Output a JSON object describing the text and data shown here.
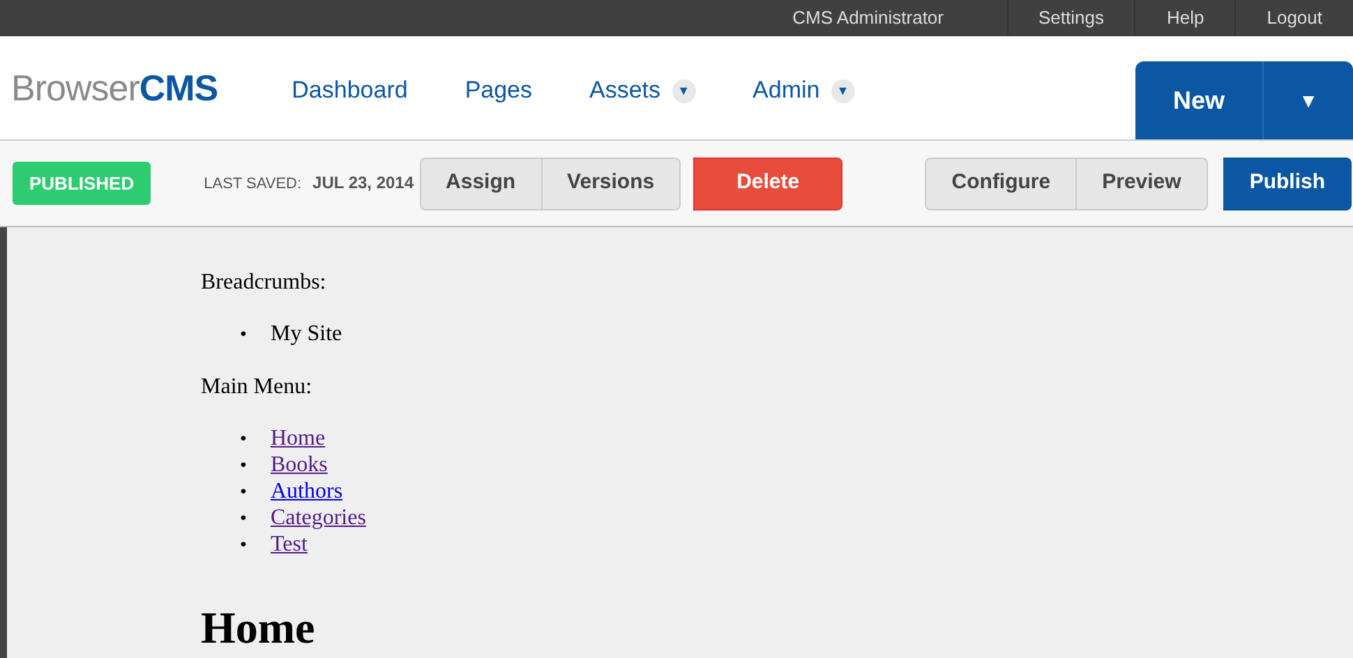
{
  "top_bar": {
    "user": "CMS Administrator",
    "links": [
      "Settings",
      "Help",
      "Logout"
    ]
  },
  "header": {
    "logo": "Browser**CMS**",
    "nav": [
      {
        "label": "Dashboard"
      },
      {
        "label": "Pages"
      },
      {
        "label": "Assets",
        "caret": "▼"
      },
      {
        "label": "Admin",
        "caret": "▼"
      }
    ],
    "new_button": {
      "label": "New",
      "caret": "▼"
    }
  },
  "toolbar": {
    "status": "PUBLISHED",
    "last_saved_label": "LAST SAVED:",
    "last_saved_date": "JUL 23, 2014",
    "groups": [
      {
        "buttons": [
          {
            "label": "Assign",
            "kind": "default"
          },
          {
            "label": "Versions",
            "kind": "default"
          }
        ]
      },
      {
        "buttons": [
          {
            "label": "Delete",
            "kind": "danger"
          }
        ]
      },
      {
        "buttons": [
          {
            "label": "Configure",
            "kind": "default"
          },
          {
            "label": "Preview",
            "kind": "default"
          }
        ]
      },
      {
        "buttons": [
          {
            "label": "Publish",
            "kind": "primary"
          }
        ]
      }
    ]
  },
  "content": {
    "breadcrumbs_label": "Breadcrumbs:",
    "breadcrumbs": [
      {
        "bullet": "•",
        "label": "My Site"
      }
    ],
    "menu_label": "Main Menu:",
    "menu": [
      {
        "bullet": "•",
        "label": "Home",
        "visited": true
      },
      {
        "bullet": "•",
        "label": "Books",
        "visited": true
      },
      {
        "bullet": "•",
        "label": "Authors",
        "visited": false
      },
      {
        "bullet": "•",
        "label": "Categories",
        "visited": true
      },
      {
        "bullet": "•",
        "label": "Test",
        "visited": true
      }
    ],
    "heading": "Home"
  }
}
